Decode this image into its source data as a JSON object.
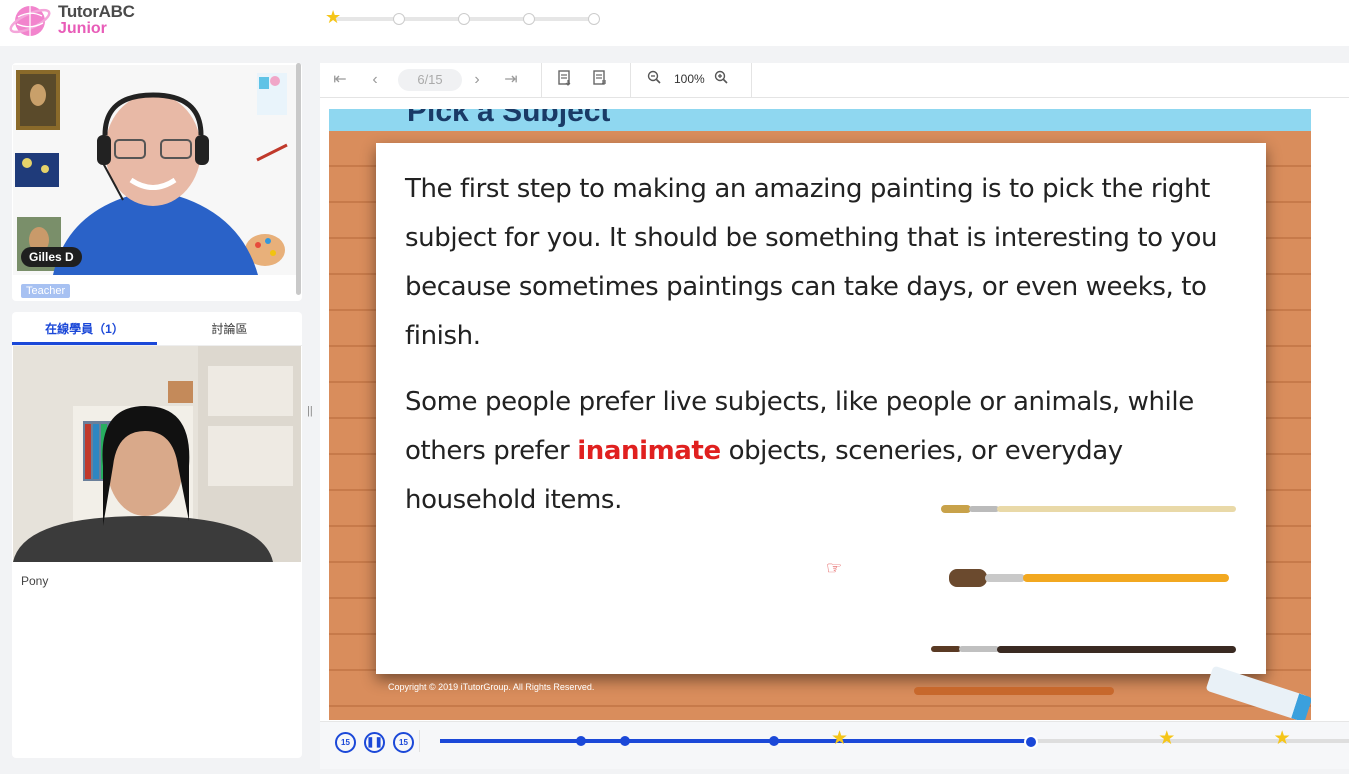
{
  "app": {
    "logo_line1": "TutorABC",
    "logo_line2": "Junior",
    "brand_color": "#e85cb8",
    "accent_color": "#1b48d8"
  },
  "top_progress": {
    "stars_earned": 1,
    "total_steps": 5
  },
  "teacher": {
    "name": "Gilles D",
    "role_tag": "Teacher"
  },
  "students_panel": {
    "tabs": [
      {
        "label": "在線學員（1）",
        "active": true
      },
      {
        "label": "討論區",
        "active": false
      }
    ],
    "students": [
      {
        "name": "Pony"
      }
    ]
  },
  "toolbar": {
    "page_indicator": "6/15",
    "zoom": "100%",
    "icons": [
      "first-page-icon",
      "prev-page-icon",
      "next-page-icon",
      "last-page-icon",
      "doc-download-icon",
      "doc-list-icon",
      "zoom-out-icon",
      "zoom-in-icon"
    ]
  },
  "slide": {
    "title_partial": "Pick a Subject",
    "paragraph1": "The first step to making an amazing painting is to pick the right subject for you. It should be something that is interesting to you because sometimes paintings can take days, or even weeks, to finish.",
    "paragraph2_before": "Some people prefer live subjects, like people or animals, while others prefer ",
    "paragraph2_highlight": "inanimate",
    "paragraph2_after": " objects, sceneries, or everyday household items.",
    "copyright": "Copyright © 2019 iTutorGroup. All Rights Reserved."
  },
  "playback": {
    "rewind_label": "15",
    "forward_label": "15",
    "progress_fraction": 0.65,
    "markers": [
      {
        "type": "dot",
        "fraction": 0.155
      },
      {
        "type": "dot",
        "fraction": 0.203
      },
      {
        "type": "dot",
        "fraction": 0.367
      },
      {
        "type": "star",
        "fraction": 0.44
      },
      {
        "type": "star",
        "fraction": 0.8
      },
      {
        "type": "star",
        "fraction": 0.927
      }
    ]
  }
}
